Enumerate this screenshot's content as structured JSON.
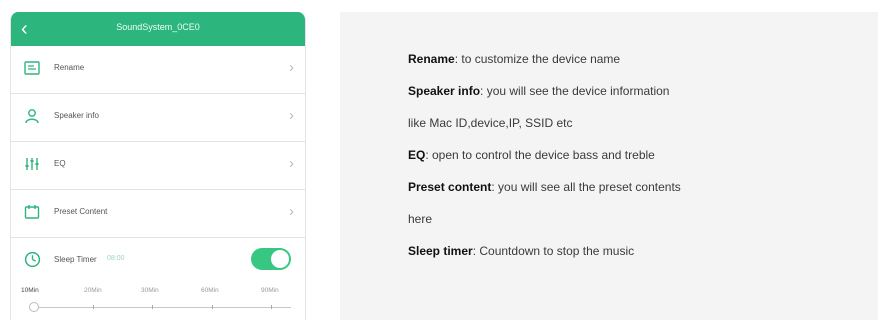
{
  "app": {
    "title": "SoundSystem_0CE0"
  },
  "settings": {
    "items": [
      {
        "label": "Rename",
        "icon": "rename-icon"
      },
      {
        "label": "Speaker info",
        "icon": "person-icon"
      },
      {
        "label": "EQ",
        "icon": "equalizer-icon"
      },
      {
        "label": "Preset Content",
        "icon": "preset-icon"
      }
    ],
    "sleep_timer": {
      "label": "Sleep Timer",
      "time": "08:00",
      "enabled": true
    },
    "ticks": [
      "10Min",
      "20Min",
      "30Min",
      "60Min",
      "90Min"
    ]
  },
  "info": {
    "lines": [
      {
        "term": "Rename",
        "text": ": to customize the device name"
      },
      {
        "term": "Speaker info",
        "text": ": you will see the device information"
      },
      {
        "term": "",
        "text": "like Mac ID,device,IP, SSID etc"
      },
      {
        "term": "EQ",
        "text": ": open to control the device bass and treble"
      },
      {
        "term": "Preset content",
        "text": ": you will see all the preset contents"
      },
      {
        "term": "",
        "text": "here"
      },
      {
        "term": "Sleep timer",
        "text": ": Countdown to stop the music"
      }
    ]
  },
  "colors": {
    "accent": "#2db57e"
  }
}
